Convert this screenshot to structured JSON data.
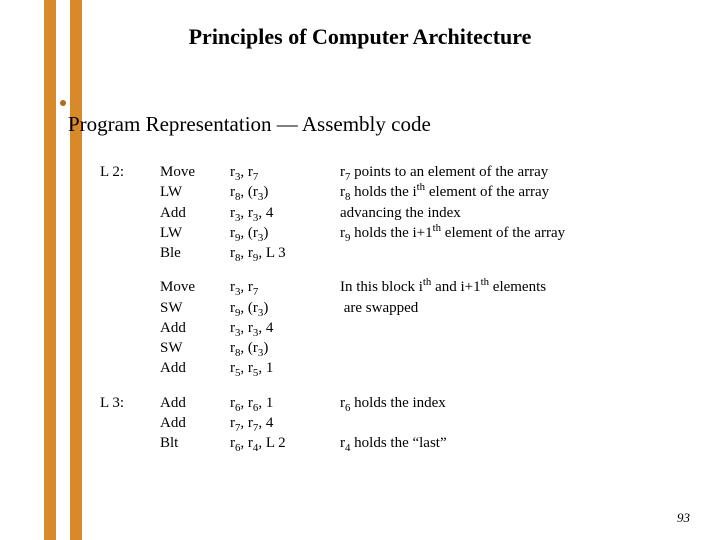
{
  "title": "Principles of Computer Architecture",
  "section": "Program Representation — Assembly code",
  "page_number": "93",
  "blocks": [
    {
      "label": "L 2:",
      "lines": [
        {
          "op": "Move",
          "args_html": "r<sub>3</sub>, r<sub>7</sub>",
          "note_html": "r<sub>7</sub> points to an element of the array"
        },
        {
          "op": "LW",
          "args_html": "r<sub>8</sub>, (r<sub>3</sub>)",
          "note_html": "r<sub>8</sub> holds the i<sup>th</sup> element of the array"
        },
        {
          "op": "Add",
          "args_html": "r<sub>3</sub>, r<sub>3</sub>, 4",
          "note_html": "advancing the index"
        },
        {
          "op": "LW",
          "args_html": "r<sub>9</sub>, (r<sub>3</sub>)",
          "note_html": "r<sub>9</sub> holds the i+1<sup>th</sup> element of the array"
        },
        {
          "op": "Ble",
          "args_html": "r<sub>8</sub>, r<sub>9</sub>, L 3",
          "note_html": ""
        }
      ]
    },
    {
      "label": "",
      "lines": [
        {
          "op": "Move",
          "args_html": "r<sub>3</sub>, r<sub>7</sub>",
          "note_html": "In this block i<sup>th</sup> and i+1<sup>th</sup> elements"
        },
        {
          "op": "SW",
          "args_html": "r<sub>9</sub>, (r<sub>3</sub>)",
          "note_html": "&nbsp;are swapped"
        },
        {
          "op": "Add",
          "args_html": "r<sub>3</sub>, r<sub>3</sub>, 4",
          "note_html": ""
        },
        {
          "op": "SW",
          "args_html": "r<sub>8</sub>, (r<sub>3</sub>)",
          "note_html": ""
        },
        {
          "op": "Add",
          "args_html": "r<sub>5</sub>, r<sub>5</sub>, 1",
          "note_html": ""
        }
      ]
    },
    {
      "label": "L 3:",
      "lines": [
        {
          "op": "Add",
          "args_html": "r<sub>6</sub>, r<sub>6</sub>, 1",
          "note_html": "r<sub>6</sub> holds the index"
        },
        {
          "op": "Add",
          "args_html": "r<sub>7</sub>, r<sub>7</sub>, 4",
          "note_html": ""
        },
        {
          "op": "Blt",
          "args_html": "r<sub>6</sub>, r<sub>4</sub>, L 2",
          "note_html": "r<sub>4</sub> holds the “last”"
        }
      ]
    }
  ]
}
